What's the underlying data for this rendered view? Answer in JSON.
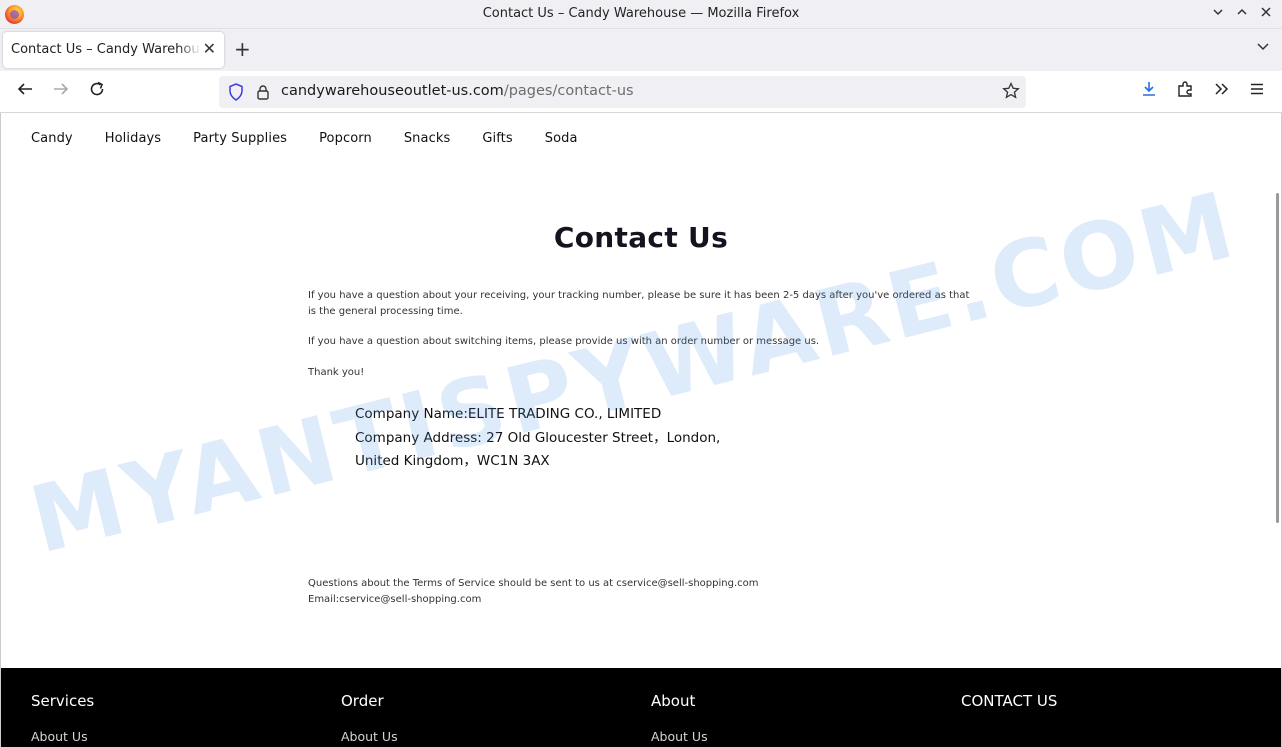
{
  "browser": {
    "window_title": "Contact Us – Candy Warehouse — Mozilla Firefox",
    "tab_title": "Contact Us – Candy Warehouse",
    "url_domain": "candywarehouseoutlet-us.com",
    "url_path": "/pages/contact-us"
  },
  "site_nav": {
    "items": [
      "Candy",
      "Holidays",
      "Party Supplies",
      "Popcorn",
      "Snacks",
      "Gifts",
      "Soda"
    ]
  },
  "main": {
    "heading": "Contact Us",
    "para1": "If you have a question about your receiving, your tracking number, please be sure it has been 2-5 days after you've ordered as that is the general processing time.",
    "para2": "If you have a question about switching items, please provide us with an order number or message us.",
    "para3": "Thank you!",
    "company_name": "Company Name:ELITE TRADING CO., LIMITED",
    "company_address_1": "Company Address: 27 Old Gloucester Street，London,",
    "company_address_2": "United Kingdom，WC1N 3AX",
    "tos_line": "Questions about the Terms of Service should be sent to us at cservice@sell-shopping.com",
    "email_line": "Email:cservice@sell-shopping.com"
  },
  "watermark": "MYANTISPYWARE.COM",
  "footer": {
    "columns": [
      {
        "title": "Services",
        "link": "About Us"
      },
      {
        "title": "Order",
        "link": "About Us"
      },
      {
        "title": "About",
        "link": "About Us"
      },
      {
        "title": "CONTACT US",
        "link": ""
      }
    ]
  },
  "colors": {
    "chrome_bg": "#f0f0f4",
    "footer_bg": "#000000",
    "watermark": "#4a90e2"
  }
}
